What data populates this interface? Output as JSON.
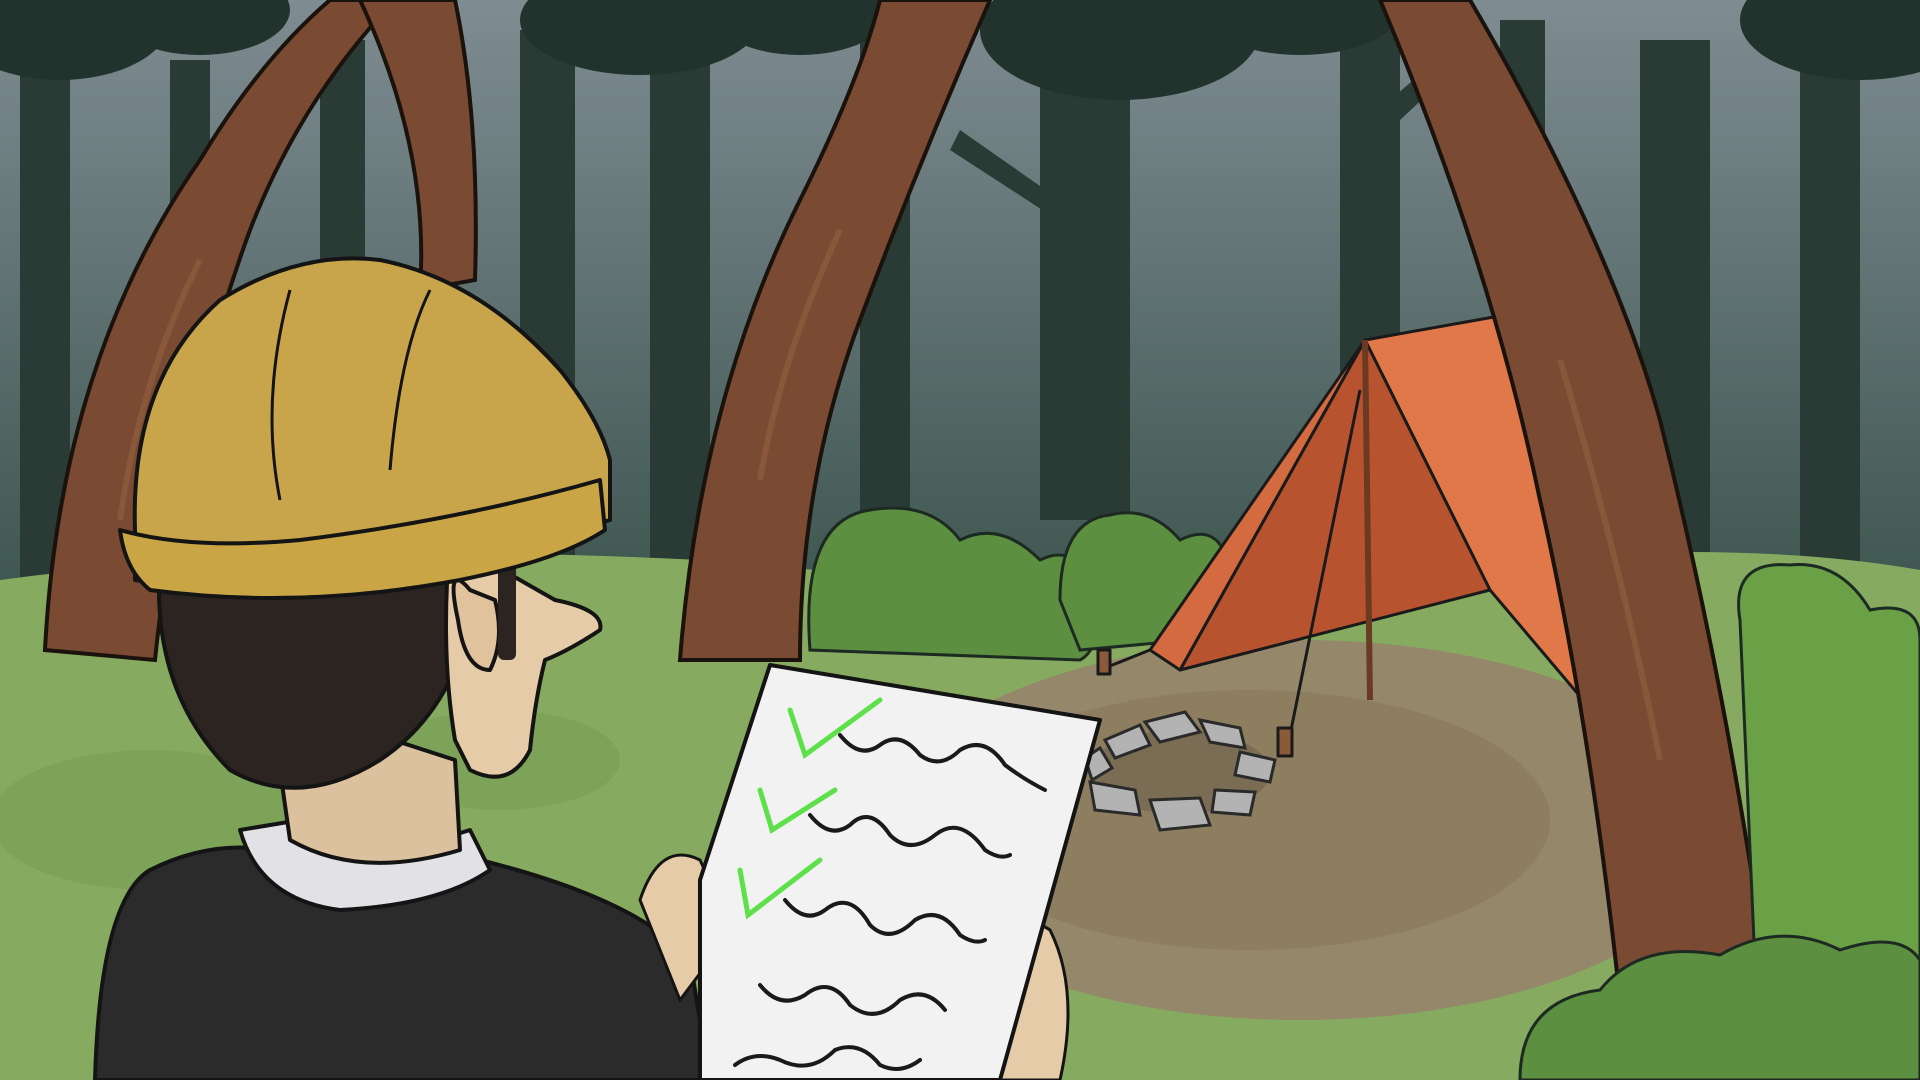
{
  "scene": {
    "description_visible_text": "",
    "colors": {
      "sky_top": "#7f8c92",
      "sky_bottom": "#37524a",
      "far_trees": "#2c3d38",
      "mid_trees": "#243530",
      "trunk": "#7a4a32",
      "trunk_highlight": "#8a5638",
      "grass": "#8aaf63",
      "grass_dark": "#6f9a50",
      "bush": "#5f9140",
      "bush_dark": "#4d7b33",
      "dirt": "#9a8a6a",
      "tent_light": "#e0784a",
      "tent_dark": "#b5502f",
      "stone": "#b8b8b8",
      "hardhat": "#c8a54a",
      "hair": "#2a2420",
      "skin": "#e6cba8",
      "shirt": "#2b2b2b",
      "collar": "#e2e2e6",
      "paper": "#f2f2f2",
      "check": "#5ee04a",
      "scribble": "#1a1a1a"
    },
    "icons": {
      "checklist_checks": 3,
      "checklist_lines": 5
    }
  }
}
